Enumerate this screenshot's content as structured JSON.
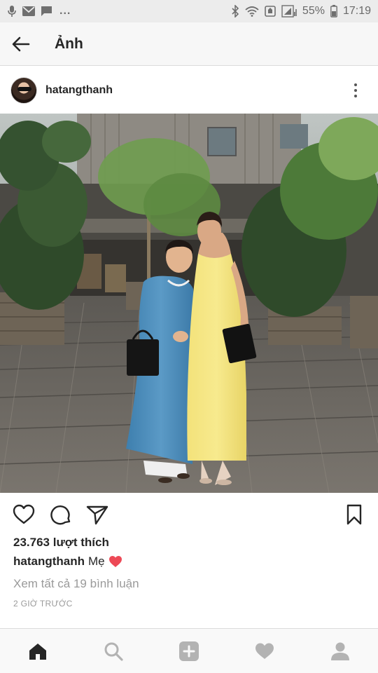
{
  "status_bar": {
    "dots": "...",
    "battery_percent": "55%",
    "time": "17:19"
  },
  "app_bar": {
    "title": "Ảnh"
  },
  "post": {
    "username": "hatangthanh",
    "likes": "23.763 lượt thích",
    "caption_user": "hatangthanh",
    "caption_text": "Mẹ",
    "view_comments": "Xem tất cả 19 bình luận",
    "timestamp": "2 GIỜ TRƯỚC"
  },
  "colors": {
    "like_heart": "#ed4956",
    "text": "#262626",
    "muted": "#9a9a9a"
  },
  "icons": {
    "status_left": [
      "mic-icon",
      "mail-icon",
      "message-icon"
    ],
    "status_right": [
      "bluetooth-icon",
      "wifi-icon",
      "nfc-icon",
      "signal-icon",
      "battery-icon"
    ],
    "actions": [
      "heart-icon",
      "comment-icon",
      "share-icon",
      "bookmark-icon"
    ],
    "nav": [
      "home-icon",
      "search-icon",
      "add-icon",
      "activity-icon",
      "profile-icon"
    ]
  }
}
